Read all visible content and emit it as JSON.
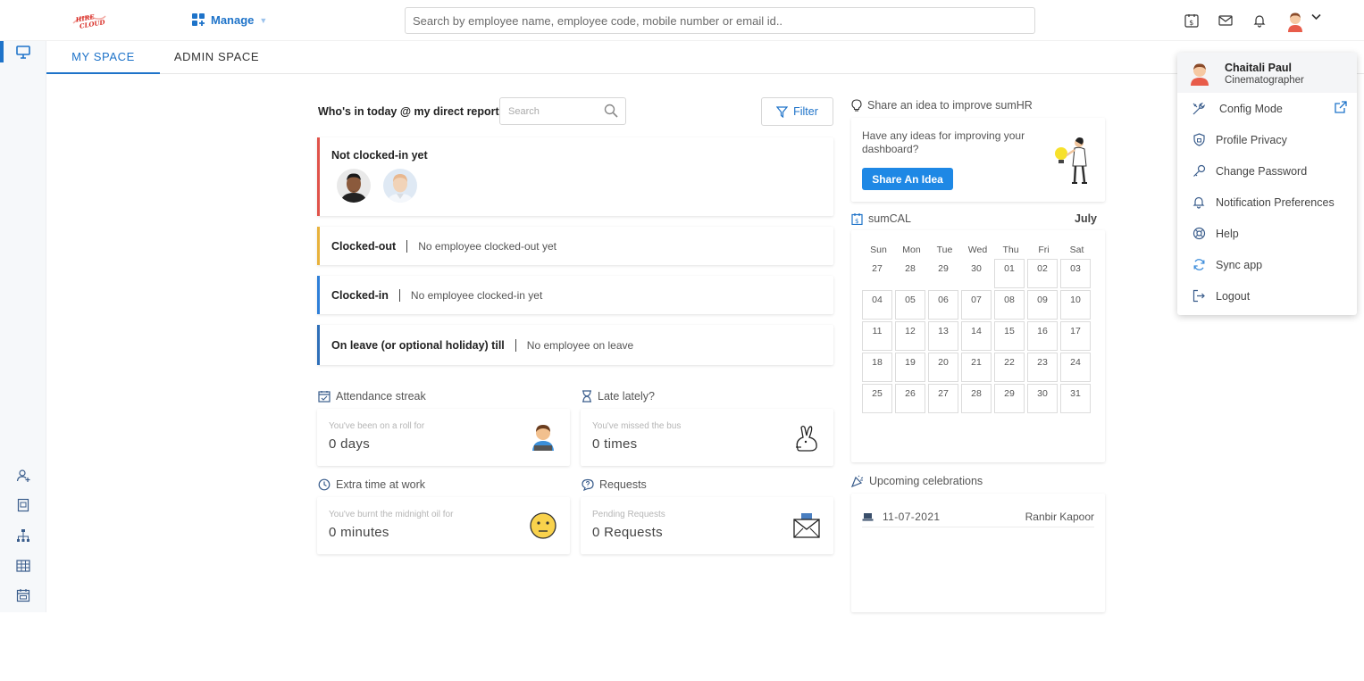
{
  "header": {
    "logo_text": "HIRE CLOUD",
    "manage_label": "Manage",
    "search_placeholder": "Search by employee name, employee code, mobile number or email id.."
  },
  "tabs": [
    {
      "label": "MY SPACE",
      "active": true
    },
    {
      "label": "ADMIN SPACE",
      "active": false
    }
  ],
  "whos_in": {
    "title": "Who's in today @ my direct report",
    "search_placeholder": "Search",
    "filter_label": "Filter",
    "groups": [
      {
        "label": "Not clocked-in yet",
        "message": "",
        "color": "#e0534a"
      },
      {
        "label": "Clocked-out",
        "message": "No employee clocked-out yet",
        "color": "#e8b23c"
      },
      {
        "label": "Clocked-in",
        "message": "No employee clocked-in yet",
        "color": "#2e7fd8"
      },
      {
        "label": "On leave (or optional holiday) till",
        "message": "No employee on leave",
        "color": "#2e6fb8"
      }
    ]
  },
  "stats": {
    "attendance": {
      "title": "Attendance streak",
      "sub": "You've been on a roll for",
      "value": "0 days"
    },
    "late": {
      "title": "Late lately?",
      "sub": "You've missed the bus",
      "value": "0 times"
    },
    "extra": {
      "title": "Extra time at work",
      "sub": "You've burnt the midnight oil for",
      "value": "0 minutes"
    },
    "requests": {
      "title": "Requests",
      "sub": "Pending Requests",
      "value": "0 Requests"
    }
  },
  "idea": {
    "title": "Share an idea to improve sumHR",
    "text": "Have any ideas for improving your dashboard?",
    "button": "Share An Idea"
  },
  "calendar": {
    "title": "sumCAL",
    "month": "July",
    "weekdays": [
      "Sun",
      "Mon",
      "Tue",
      "Wed",
      "Thu",
      "Fri",
      "Sat"
    ],
    "days": [
      {
        "d": "27",
        "muted": true
      },
      {
        "d": "28",
        "muted": true
      },
      {
        "d": "29",
        "muted": true
      },
      {
        "d": "30",
        "muted": true
      },
      {
        "d": "01"
      },
      {
        "d": "02"
      },
      {
        "d": "03"
      },
      {
        "d": "04"
      },
      {
        "d": "05"
      },
      {
        "d": "06"
      },
      {
        "d": "07"
      },
      {
        "d": "08"
      },
      {
        "d": "09"
      },
      {
        "d": "10"
      },
      {
        "d": "11"
      },
      {
        "d": "12"
      },
      {
        "d": "13"
      },
      {
        "d": "14"
      },
      {
        "d": "15"
      },
      {
        "d": "16"
      },
      {
        "d": "17"
      },
      {
        "d": "18"
      },
      {
        "d": "19"
      },
      {
        "d": "20"
      },
      {
        "d": "21"
      },
      {
        "d": "22"
      },
      {
        "d": "23"
      },
      {
        "d": "24"
      },
      {
        "d": "25"
      },
      {
        "d": "26"
      },
      {
        "d": "27"
      },
      {
        "d": "28"
      },
      {
        "d": "29"
      },
      {
        "d": "30"
      },
      {
        "d": "31"
      }
    ]
  },
  "celebrations": {
    "title": "Upcoming celebrations",
    "items": [
      {
        "date": "11-07-2021",
        "name": "Ranbir Kapoor"
      }
    ]
  },
  "profile_menu": {
    "name": "Chaitali Paul",
    "role": "Cinematographer",
    "items": [
      {
        "label": "Config Mode",
        "icon": "tools-icon"
      },
      {
        "label": "Profile Privacy",
        "icon": "shield-icon"
      },
      {
        "label": "Change Password",
        "icon": "key-icon"
      },
      {
        "label": "Notification Preferences",
        "icon": "bell-icon"
      },
      {
        "label": "Help",
        "icon": "lifebuoy-icon"
      },
      {
        "label": "Sync app",
        "icon": "sync-icon"
      },
      {
        "label": "Logout",
        "icon": "logout-icon"
      }
    ]
  },
  "colors": {
    "accent": "#1e73c9",
    "button": "#1e88e5"
  }
}
